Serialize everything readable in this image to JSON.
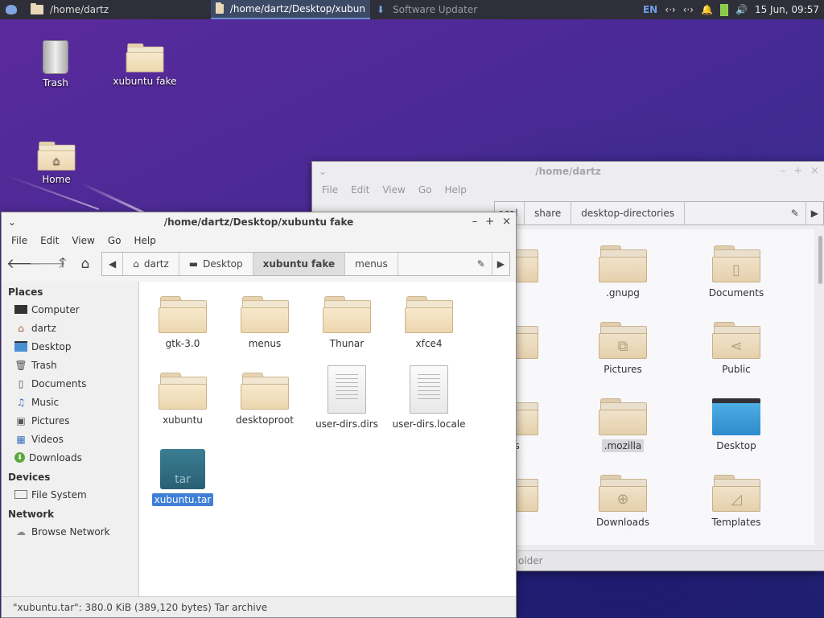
{
  "panel": {
    "tasks": [
      {
        "label": "/home/dartz"
      },
      {
        "label": "/home/dartz/Desktop/xubun"
      },
      {
        "label": "Software Updater"
      }
    ],
    "lang": "EN",
    "clock": "15 Jun, 09:57"
  },
  "desktop": {
    "icons": [
      {
        "label": "Trash"
      },
      {
        "label": "xubuntu fake"
      },
      {
        "label": "Home"
      }
    ]
  },
  "back_window": {
    "title": "/home/dartz",
    "menu": [
      "File",
      "Edit",
      "View",
      "Go",
      "Help"
    ],
    "path": [
      "ocal",
      "share",
      "desktop-directories"
    ],
    "items": [
      {
        "label": "l",
        "icon": "folder"
      },
      {
        "label": ".gnupg",
        "icon": "folder"
      },
      {
        "label": "Documents",
        "icon": "folder-documents"
      },
      {
        "label": "c",
        "icon": "folder"
      },
      {
        "label": "Pictures",
        "icon": "folder-pictures"
      },
      {
        "label": "Public",
        "icon": "folder-share"
      },
      {
        "label": "os",
        "icon": "folder"
      },
      {
        "label": ".mozilla",
        "icon": "folder"
      },
      {
        "label": "Desktop",
        "icon": "folder-desktop"
      },
      {
        "label": "o",
        "icon": "folder"
      },
      {
        "label": "Downloads",
        "icon": "folder-downloads"
      },
      {
        "label": "Templates",
        "icon": "folder-templates"
      }
    ],
    "status": "older"
  },
  "front_window": {
    "title": "/home/dartz/Desktop/xubuntu fake",
    "menu": [
      "File",
      "Edit",
      "View",
      "Go",
      "Help"
    ],
    "path": [
      "dartz",
      "Desktop",
      "xubuntu fake",
      "menus"
    ],
    "sidebar": {
      "places_header": "Places",
      "places": [
        {
          "label": "Computer",
          "icon": "monitor-icon"
        },
        {
          "label": "dartz",
          "icon": "home-icon"
        },
        {
          "label": "Desktop",
          "icon": "desktop-icon"
        },
        {
          "label": "Trash",
          "icon": "trash-icon"
        },
        {
          "label": "Documents",
          "icon": "document-icon"
        },
        {
          "label": "Music",
          "icon": "music-icon"
        },
        {
          "label": "Pictures",
          "icon": "pictures-icon"
        },
        {
          "label": "Videos",
          "icon": "videos-icon"
        },
        {
          "label": "Downloads",
          "icon": "downloads-icon"
        }
      ],
      "devices_header": "Devices",
      "devices": [
        {
          "label": "File System",
          "icon": "drive-icon"
        }
      ],
      "network_header": "Network",
      "network": [
        {
          "label": "Browse Network",
          "icon": "network-icon"
        }
      ]
    },
    "files": [
      {
        "label": "gtk-3.0",
        "icon": "folder"
      },
      {
        "label": "menus",
        "icon": "folder"
      },
      {
        "label": "Thunar",
        "icon": "folder"
      },
      {
        "label": "xfce4",
        "icon": "folder"
      },
      {
        "label": "xubuntu",
        "icon": "folder"
      },
      {
        "label": "desktoproot",
        "icon": "folder"
      },
      {
        "label": "user-dirs.dirs",
        "icon": "text"
      },
      {
        "label": "user-dirs.locale",
        "icon": "text"
      },
      {
        "label": "xubuntu.tar",
        "icon": "tar",
        "badge": "tar"
      }
    ],
    "status": "\"xubuntu.tar\": 380.0 KiB (389,120 bytes) Tar archive"
  }
}
